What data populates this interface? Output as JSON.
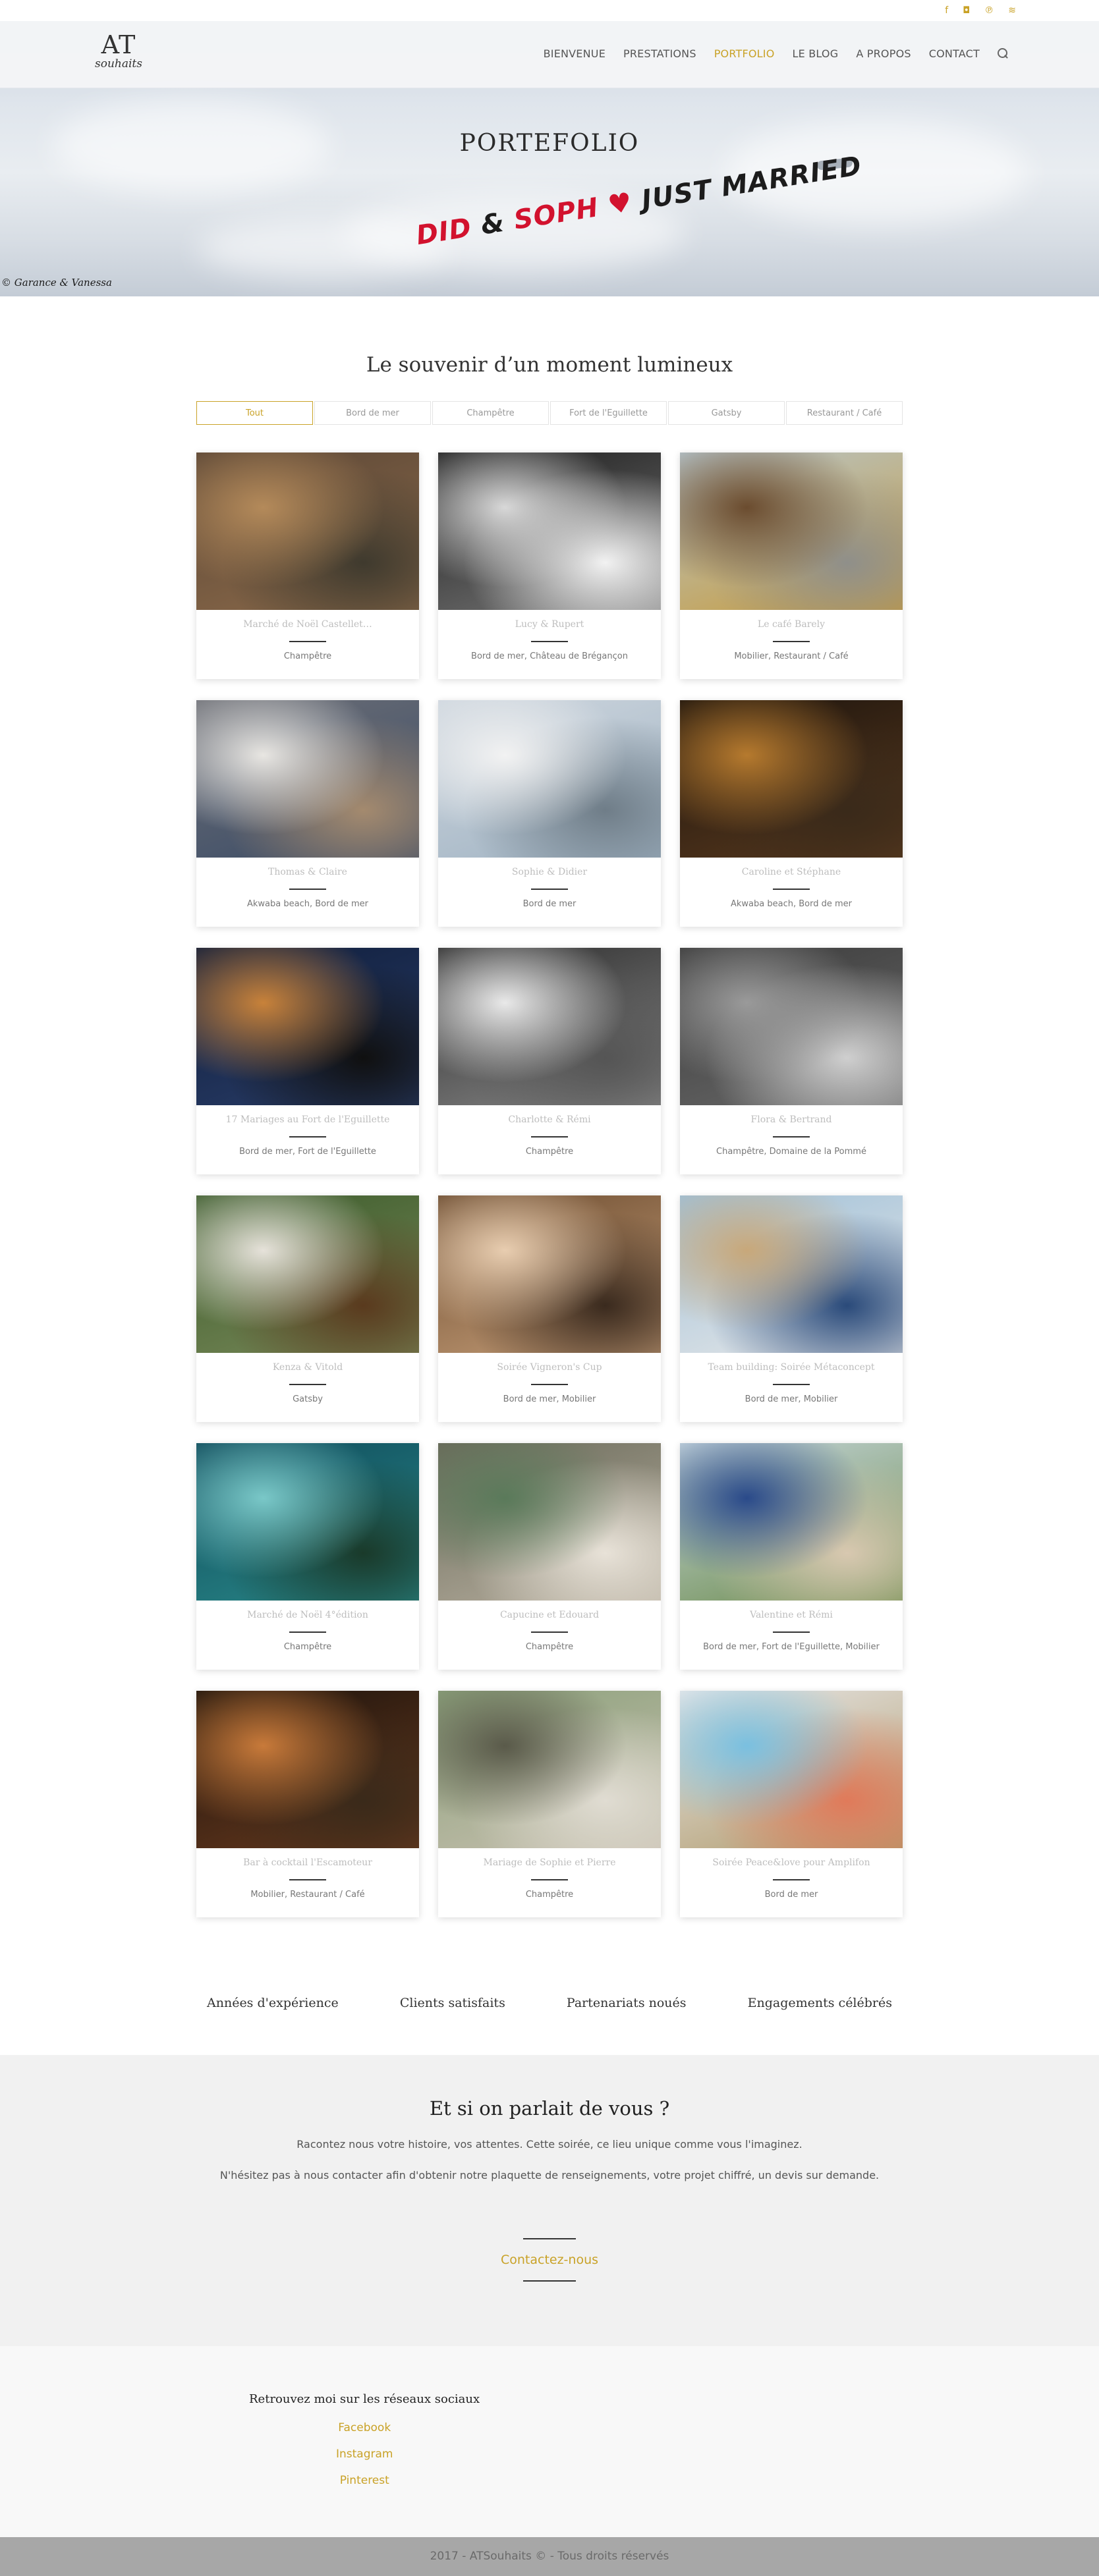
{
  "social_top": [
    {
      "icon": "facebook-icon",
      "glyph": "f"
    },
    {
      "icon": "instagram-icon",
      "glyph": "◘"
    },
    {
      "icon": "pinterest-icon",
      "glyph": "℗"
    },
    {
      "icon": "rss-icon",
      "glyph": "≋"
    }
  ],
  "logo": {
    "line1": "AT",
    "line2": "souhaits"
  },
  "nav": [
    {
      "label": "BIENVENUE",
      "active": false
    },
    {
      "label": "PRESTATIONS",
      "active": false
    },
    {
      "label": "PORTFOLIO",
      "active": true
    },
    {
      "label": "LE BLOG",
      "active": false
    },
    {
      "label": "A PROPOS",
      "active": false
    },
    {
      "label": "CONTACT",
      "active": false
    }
  ],
  "hero": {
    "title": "PORTEFOLIO",
    "banner_name1": "DID",
    "banner_amp": "&",
    "banner_name2": "SOPH",
    "banner_heart": "♥",
    "banner_text": "JUST MARRIED",
    "credit": "© Garance & Vanessa"
  },
  "section_title": "Le souvenir d’un moment lumineux",
  "filters": [
    {
      "label": "Tout",
      "active": true
    },
    {
      "label": "Bord de mer",
      "active": false
    },
    {
      "label": "Champêtre",
      "active": false
    },
    {
      "label": "Fort de l'Eguillette",
      "active": false
    },
    {
      "label": "Gatsby",
      "active": false
    },
    {
      "label": "Restaurant / Café",
      "active": false
    }
  ],
  "portfolio": [
    {
      "title": "Marché de Noël Castellet…",
      "categories": "Champêtre",
      "palette": [
        "#5a4636",
        "#8d6b4a",
        "#b48a5a",
        "#3f3a2e"
      ]
    },
    {
      "title": "Lucy & Rupert",
      "categories": "Bord de mer, Château de Brégançon",
      "palette": [
        "#1a1a1a",
        "#7a7a7a",
        "#d8d8d8",
        "#f2f2f2"
      ]
    },
    {
      "title": "Le café Barely",
      "categories": "Mobilier, Restaurant / Café",
      "palette": [
        "#b7c7cf",
        "#c79a3a",
        "#6b4c2f",
        "#8f8f8a"
      ]
    },
    {
      "title": "Thomas & Claire",
      "categories": "Akwaba beach, Bord de mer",
      "palette": [
        "#6d6f76",
        "#3a4b66",
        "#e8e6e2",
        "#a48a6e"
      ]
    },
    {
      "title": "Sophie & Didier",
      "categories": "Bord de mer",
      "palette": [
        "#cfd7df",
        "#9fb2c2",
        "#f2f2f2",
        "#6f7d88"
      ]
    },
    {
      "title": "Caroline et Stéphane",
      "categories": "Akwaba beach, Bord de mer",
      "palette": [
        "#1b130d",
        "#5a3a1e",
        "#b67a2e",
        "#3a2a1a"
      ]
    },
    {
      "title": "17 Mariages au Fort de l'Eguillette",
      "categories": "Bord de mer, Fort de l'Eguillette",
      "palette": [
        "#0f1d3a",
        "#2a3e6a",
        "#c8823a",
        "#101010"
      ]
    },
    {
      "title": "Charlotte & Rémi",
      "categories": "Champêtre",
      "palette": [
        "#2a2a2a",
        "#8a8a8a",
        "#e9e9e9",
        "#555555"
      ]
    },
    {
      "title": "Flora & Bertrand",
      "categories": "Champêtre, Domaine de la Pommé",
      "palette": [
        "#3a3a3a",
        "#6a6a6a",
        "#9a9a9a",
        "#cfcfcf"
      ]
    },
    {
      "title": "Kenza & Vitold",
      "categories": "Gatsby",
      "palette": [
        "#3a5a2a",
        "#7a8a5a",
        "#e6e2da",
        "#5a3a1e"
      ]
    },
    {
      "title": "Soirée Vigneron's Cup",
      "categories": "Bord de mer, Mobilier",
      "palette": [
        "#6a4a2e",
        "#c8a07a",
        "#e8cdb0",
        "#3a2a1e"
      ]
    },
    {
      "title": "Team building: Soirée Métaconcept",
      "categories": "Bord de mer, Mobilier",
      "palette": [
        "#9fc0d8",
        "#e8e8e8",
        "#c8a87a",
        "#2a4a7a"
      ]
    },
    {
      "title": "Marché de Noël 4°édition",
      "categories": "Champêtre",
      "palette": [
        "#0f4a5a",
        "#2a8a8a",
        "#7ac8c8",
        "#1a3a2a"
      ]
    },
    {
      "title": "Capucine et Edouard",
      "categories": "Champêtre",
      "palette": [
        "#6a6a5a",
        "#b8b0a0",
        "#5a7a5a",
        "#e8e2d8"
      ]
    },
    {
      "title": "Valentine et Rémi",
      "categories": "Bord de mer, Fort de l'Eguillette, Mobilier",
      "palette": [
        "#c8d8e0",
        "#6a8a4a",
        "#2a4a8a",
        "#d8c8b0"
      ]
    },
    {
      "title": "Bar à cocktail l'Escamoteur",
      "categories": "Mobilier, Restaurant / Café",
      "palette": [
        "#1a120c",
        "#6a3a1e",
        "#c87a3a",
        "#3a2a1a"
      ]
    },
    {
      "title": "Mariage de Sophie et Pierre",
      "categories": "Champêtre",
      "palette": [
        "#8aa07a",
        "#c8c0b0",
        "#5a5a4a",
        "#e0dcd2"
      ]
    },
    {
      "title": "Soirée Peace&love pour Amplifon",
      "categories": "Bord de mer",
      "palette": [
        "#e8e8ea",
        "#b09a6a",
        "#7ac0e0",
        "#e07a5a"
      ]
    }
  ],
  "stats": [
    "Années d'expérience",
    "Clients satisfaits",
    "Partenariats noués",
    "Engagements célébrés"
  ],
  "contact": {
    "title": "Et si on parlait de vous ?",
    "line1": "Racontez nous votre histoire, vos attentes. Cette soirée, ce lieu unique comme vous l'imaginez.",
    "line2": "N'hésitez pas à nous contacter afin d'obtenir notre plaquette de renseignements, votre projet chiffré, un devis sur demande.",
    "button": "Contactez-nous"
  },
  "footer": {
    "heading": "Retrouvez moi sur les réseaux sociaux",
    "links": [
      "Facebook",
      "Instagram",
      "Pinterest"
    ],
    "copyright": "2017 - ATSouhaits © - Tous droits réservés"
  },
  "colors": {
    "accent": "#c9a227",
    "dark": "#333333",
    "light_bg": "#f1f1f1",
    "bottom_bar": "#a7a7a7"
  }
}
